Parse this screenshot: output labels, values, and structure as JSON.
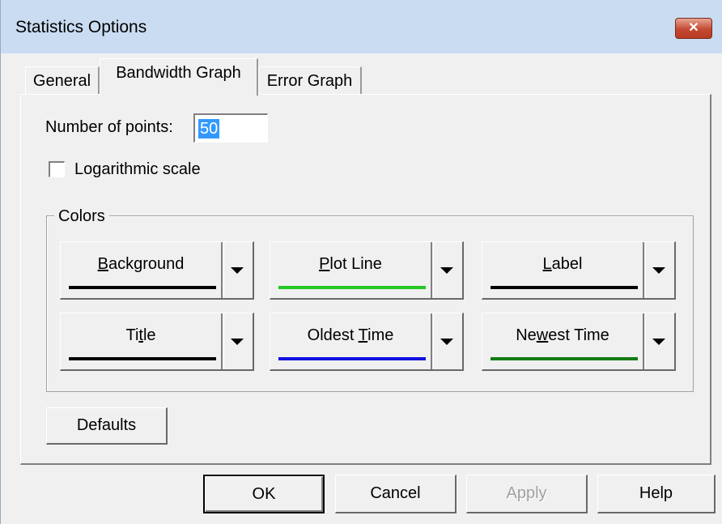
{
  "window": {
    "title": "Statistics Options",
    "close_glyph": "✕"
  },
  "tabs": [
    {
      "label": "General",
      "active": false
    },
    {
      "label": "Bandwidth Graph",
      "active": true
    },
    {
      "label": "Error Graph",
      "active": false
    }
  ],
  "bandwidth": {
    "num_points_label": "Number of points:",
    "num_points_value": "50",
    "log_scale_label": "Logarithmic scale",
    "log_scale_checked": false,
    "colors_caption": "Colors",
    "color_buttons": [
      {
        "pre": "",
        "u": "B",
        "post": "ackground",
        "color": "#000000"
      },
      {
        "pre": "",
        "u": "P",
        "post": "lot Line",
        "color": "#22c722"
      },
      {
        "pre": "",
        "u": "L",
        "post": "abel",
        "color": "#000000"
      },
      {
        "pre": "Ti",
        "u": "t",
        "post": "le",
        "color": "#000000"
      },
      {
        "pre": "Oldest ",
        "u": "T",
        "post": "ime",
        "color": "#1010e0"
      },
      {
        "pre": "Ne",
        "u": "w",
        "post": "est Time",
        "color": "#127a12"
      }
    ],
    "defaults_label": "Defaults"
  },
  "footer": {
    "ok_label": "OK",
    "cancel_label": "Cancel",
    "apply_label": "Apply",
    "help_label": "Help"
  }
}
